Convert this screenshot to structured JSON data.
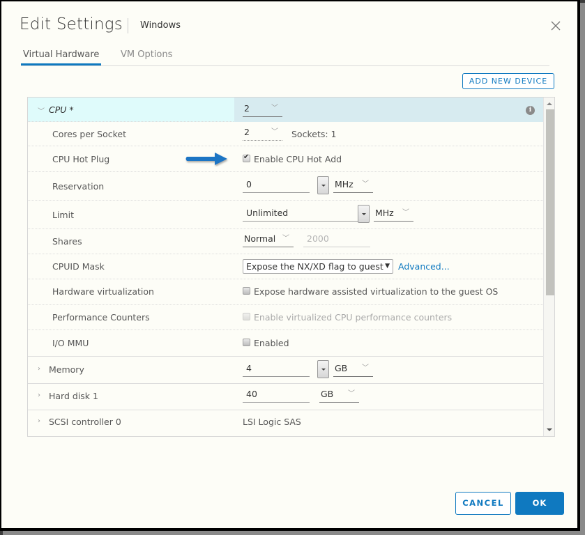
{
  "dialog": {
    "title": "Edit Settings",
    "subtitle": "Windows",
    "close_icon": "close-icon"
  },
  "tabs": [
    {
      "label": "Virtual Hardware",
      "active": true
    },
    {
      "label": "VM Options",
      "active": false
    }
  ],
  "toolbar": {
    "add_new_device_label": "ADD NEW DEVICE"
  },
  "cpu": {
    "label": "CPU *",
    "value": "2",
    "info_icon": "info-icon",
    "cores_per_socket": {
      "label": "Cores per Socket",
      "value": "2",
      "sockets_text": "Sockets: 1"
    },
    "hot_plug": {
      "label": "CPU Hot Plug",
      "checkbox_label": "Enable CPU Hot Add",
      "checked": true
    },
    "reservation": {
      "label": "Reservation",
      "value": "0",
      "unit": "MHz"
    },
    "limit": {
      "label": "Limit",
      "value": "Unlimited",
      "unit": "MHz"
    },
    "shares": {
      "label": "Shares",
      "level": "Normal",
      "value": "2000"
    },
    "cpuid_mask": {
      "label": "CPUID Mask",
      "value": "Expose the NX/XD flag to guest",
      "advanced_link": "Advanced..."
    },
    "hw_virtualization": {
      "label": "Hardware virtualization",
      "checkbox_label": "Expose hardware assisted virtualization to the guest OS",
      "checked": false
    },
    "perf_counters": {
      "label": "Performance Counters",
      "checkbox_label": "Enable virtualized CPU performance counters",
      "checked": false,
      "disabled": true
    },
    "io_mmu": {
      "label": "I/O MMU",
      "checkbox_label": "Enabled",
      "checked": false
    }
  },
  "memory": {
    "label": "Memory",
    "value": "4",
    "unit": "GB"
  },
  "hard_disk": {
    "label": "Hard disk 1",
    "value": "40",
    "unit": "GB"
  },
  "scsi": {
    "label": "SCSI controller 0",
    "value": "LSI Logic SAS"
  },
  "annotation": {
    "arrow_color": "#1f75c4"
  },
  "footer": {
    "cancel_label": "CANCEL",
    "ok_label": "OK"
  },
  "colors": {
    "accent": "#0f79c0",
    "selected_row_bg": "#dffbfb"
  }
}
